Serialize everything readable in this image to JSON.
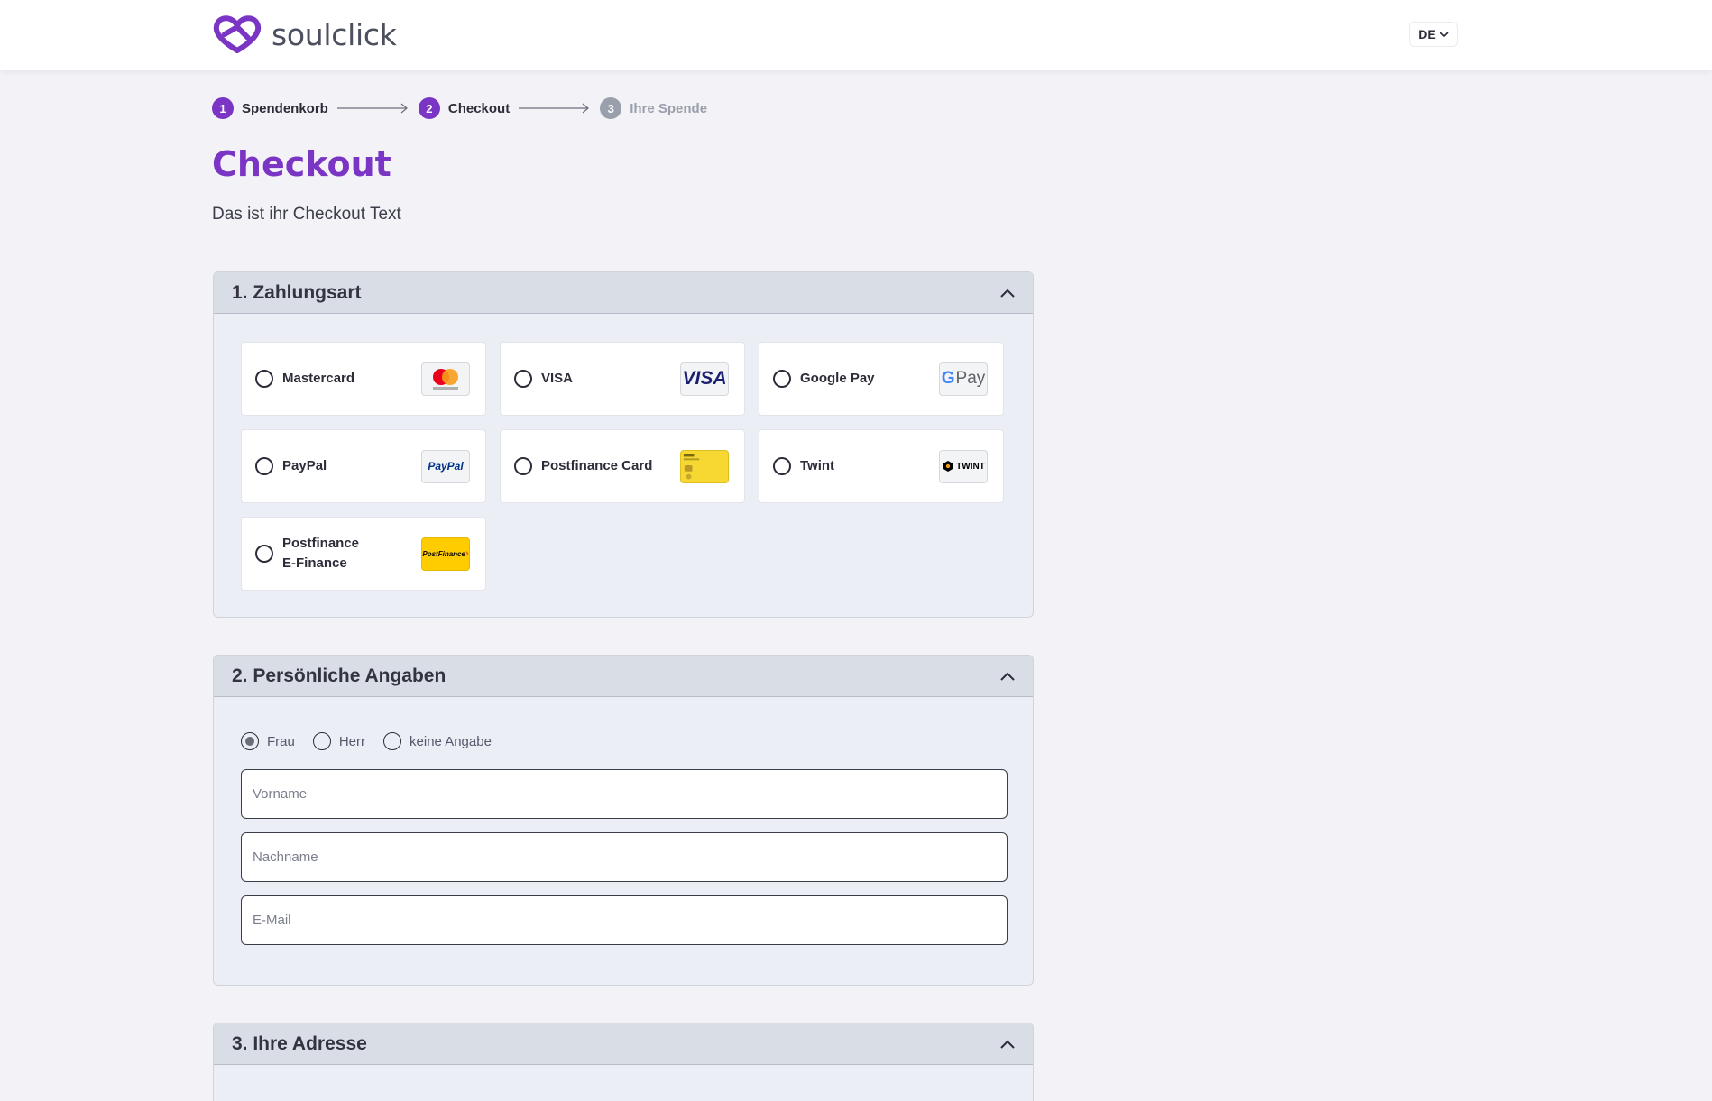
{
  "header": {
    "brand_name": "soulclick",
    "language": "DE",
    "brand_color": "#7b35c4"
  },
  "stepper": [
    {
      "number": "1",
      "label": "Spendenkorb",
      "state": "done"
    },
    {
      "number": "2",
      "label": "Checkout",
      "state": "active"
    },
    {
      "number": "3",
      "label": "Ihre Spende",
      "state": "inactive"
    }
  ],
  "page": {
    "title": "Checkout",
    "intro": "Das ist ihr Checkout Text"
  },
  "payment": {
    "title": "1. Zahlungsart",
    "methods": [
      {
        "label": "Mastercard",
        "icon": "mastercard-icon"
      },
      {
        "label": "VISA",
        "icon": "visa-icon"
      },
      {
        "label": "Google Pay",
        "icon": "google-pay-icon"
      },
      {
        "label": "PayPal",
        "icon": "paypal-icon"
      },
      {
        "label": "Postfinance Card",
        "icon": "postfinance-card-icon"
      },
      {
        "label": "Twint",
        "icon": "twint-icon"
      },
      {
        "label": "Postfinance\nE-Finance",
        "icon": "postfinance-efinance-icon"
      }
    ],
    "logo_text": {
      "visa": "VISA",
      "gpay": "Pay",
      "paypal": "PayPal",
      "twint": "TWINT",
      "postfinance": "PostFinance"
    }
  },
  "personal": {
    "title": "2. Persönliche Angaben",
    "salutations": [
      {
        "label": "Frau",
        "checked": true
      },
      {
        "label": "Herr",
        "checked": false
      },
      {
        "label": "keine Angabe",
        "checked": false
      }
    ],
    "first_name_placeholder": "Vorname",
    "last_name_placeholder": "Nachname",
    "email_placeholder": "E-Mail"
  },
  "address": {
    "title": "3. Ihre Adresse"
  }
}
